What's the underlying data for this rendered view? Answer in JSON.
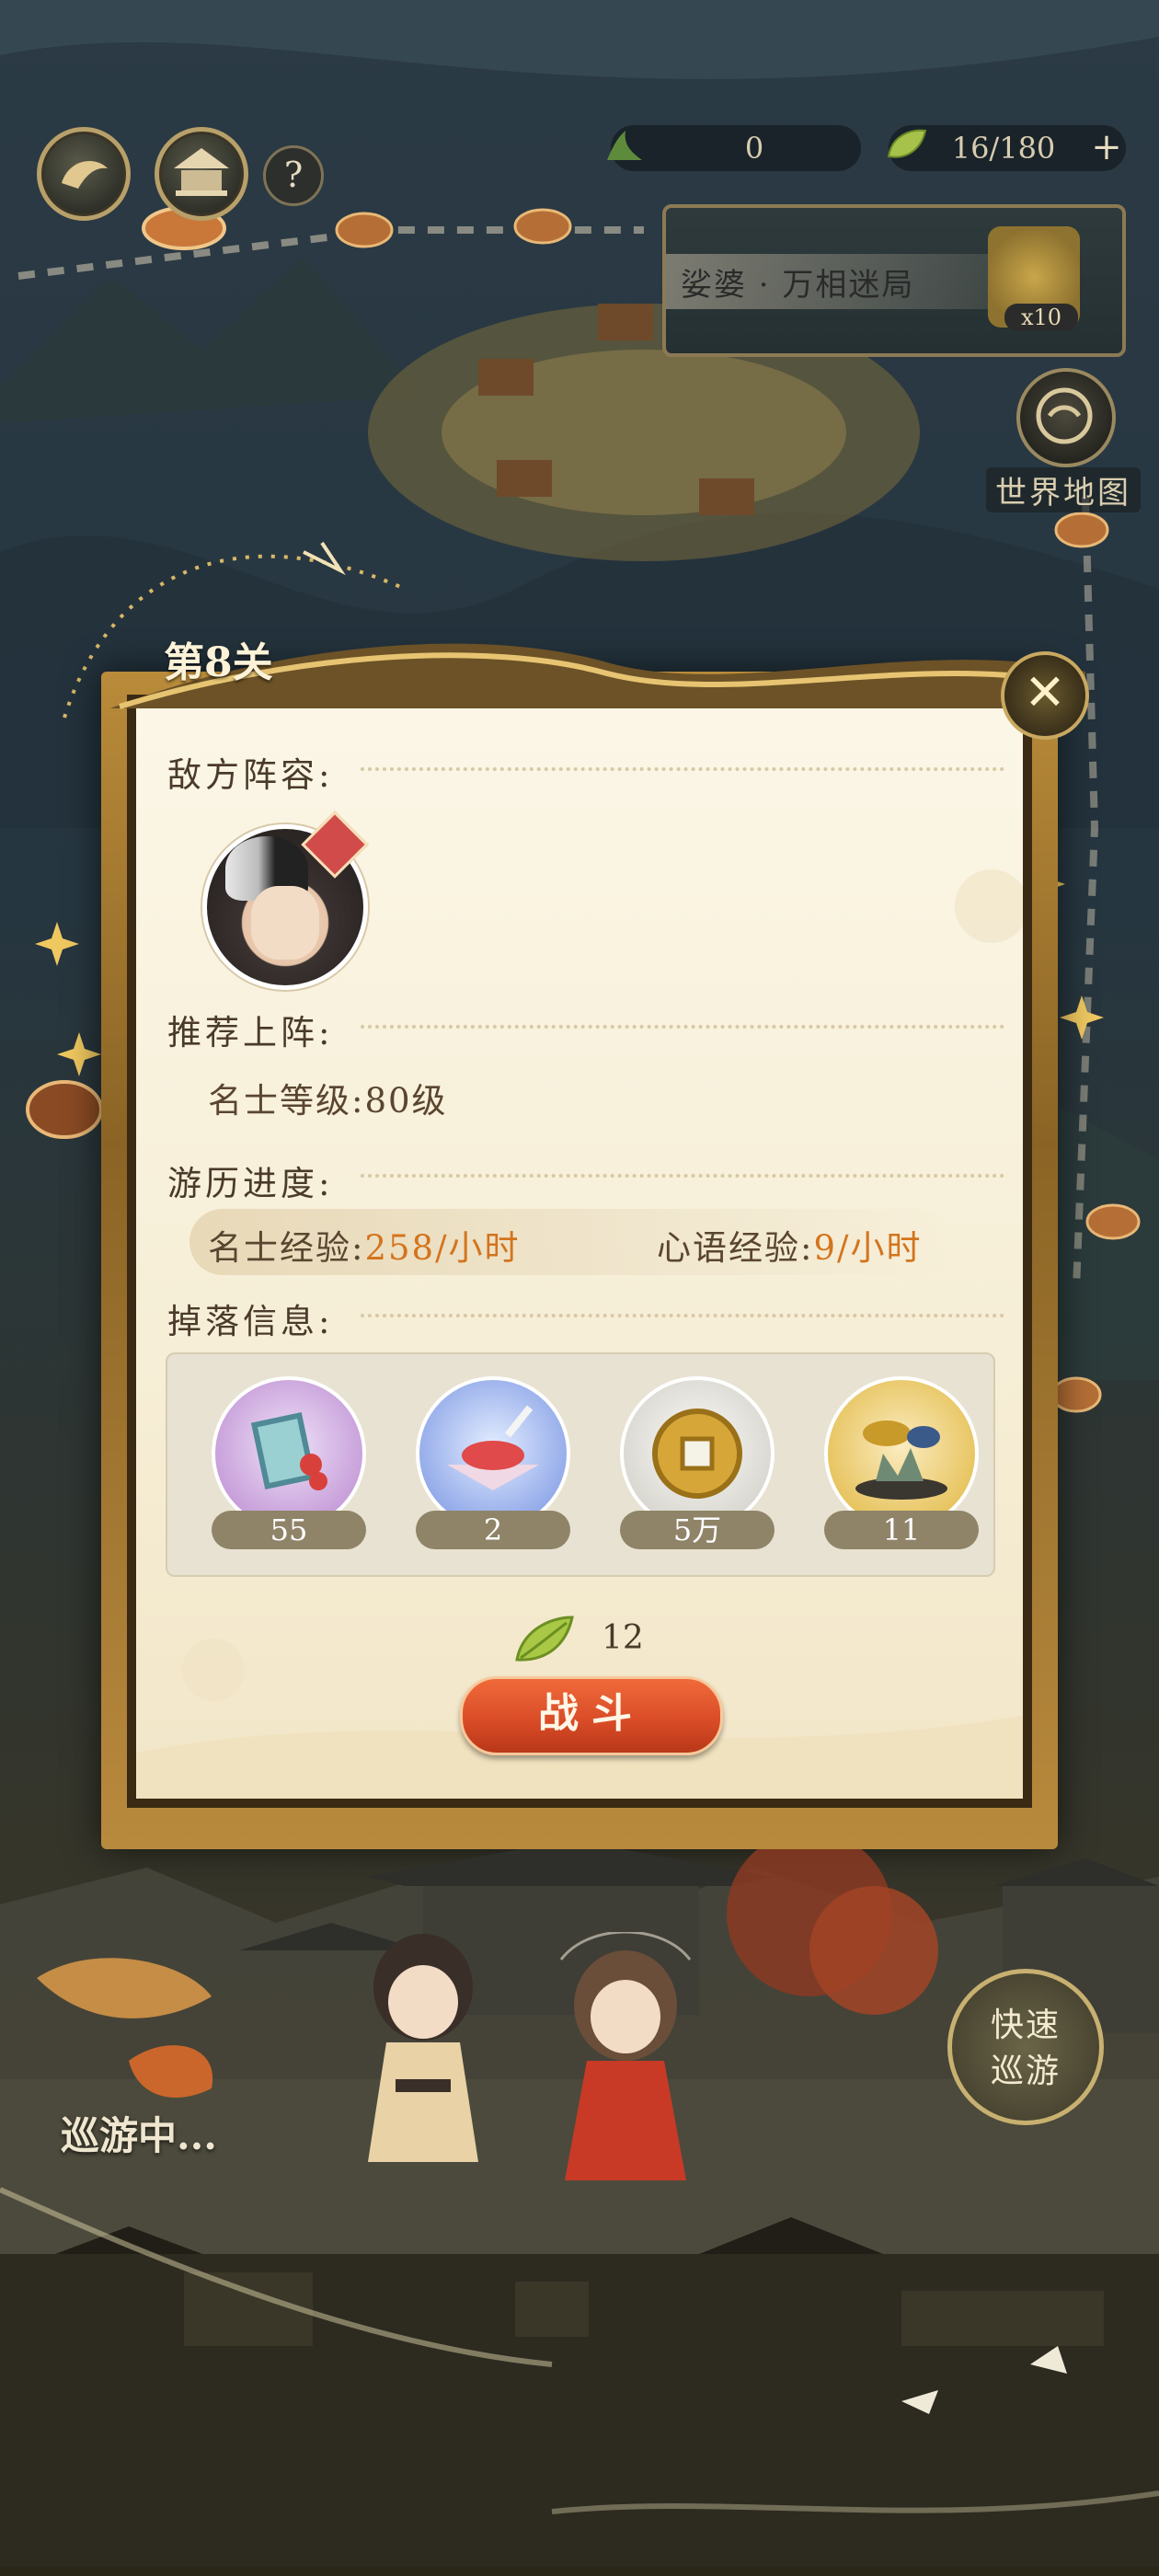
{
  "hud": {
    "currency_value": "0",
    "stamina_value": "16/180",
    "stamina_plus": "+",
    "help_label": "?"
  },
  "stage": {
    "name": "娑婆 · 万相迷局",
    "count": "x10"
  },
  "world_map": {
    "label": "世界地图"
  },
  "dialog": {
    "level_title": "第8关",
    "close_icon": "✕",
    "enemy_label": "敌方阵容:",
    "recommend_label": "推荐上阵:",
    "recommend_level_label": "名士等级:",
    "recommend_level_value": "80级",
    "progress_label": "游历进度:",
    "exp_label": "名士经验:",
    "exp_value": "258/小时",
    "heart_label": "心语经验:",
    "heart_value": "9/小时",
    "drops_label": "掉落信息:",
    "drops": [
      {
        "icon": "book-icon",
        "qty": "55",
        "color": "#c59bd8"
      },
      {
        "icon": "dessert-bowl-icon",
        "qty": "2",
        "color": "#8fa7e8"
      },
      {
        "icon": "coin-icon",
        "qty": "5万",
        "color": "#e0ded8"
      },
      {
        "icon": "bonsai-icon",
        "qty": "11",
        "color": "#e6c25a"
      }
    ],
    "cost_value": "12",
    "battle_label": "战斗"
  },
  "scene": {
    "quick_tour_label_1": "快速",
    "quick_tour_label_2": "巡游",
    "touring_label": "巡游中..."
  }
}
